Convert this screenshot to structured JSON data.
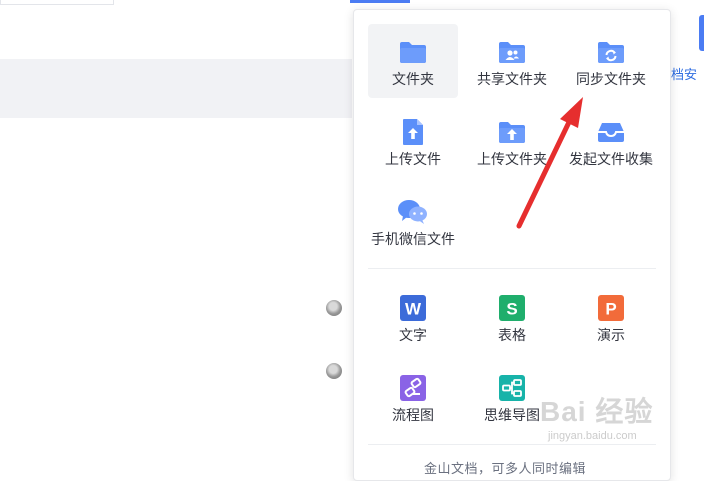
{
  "background": {
    "right_partial_text": "档安"
  },
  "new_menu": {
    "items": [
      {
        "label": "文件夹",
        "icon": "folder-icon"
      },
      {
        "label": "共享文件夹",
        "icon": "shared-folder-icon"
      },
      {
        "label": "同步文件夹",
        "icon": "sync-folder-icon"
      },
      {
        "label": "上传文件",
        "icon": "upload-file-icon"
      },
      {
        "label": "上传文件夹",
        "icon": "upload-folder-icon"
      },
      {
        "label": "发起文件收集",
        "icon": "file-collect-icon"
      },
      {
        "label": "手机微信文件",
        "icon": "wechat-icon"
      },
      {
        "label": "文字",
        "icon": "writer-doc-icon",
        "glyph": "W"
      },
      {
        "label": "表格",
        "icon": "spreadsheet-icon",
        "glyph": "S"
      },
      {
        "label": "演示",
        "icon": "presentation-icon",
        "glyph": "P"
      },
      {
        "label": "流程图",
        "icon": "flowchart-icon"
      },
      {
        "label": "思维导图",
        "icon": "mindmap-icon"
      }
    ],
    "footer": "金山文档，可多人同时编辑"
  },
  "watermark": {
    "main": "Bai 经验",
    "sub": "jingyan.baidu.com"
  },
  "colors": {
    "folder_blue": "#5b8ff9",
    "accent_blue": "#4b7cf3",
    "writer_blue": "#3c6bd9",
    "sheet_green": "#1fae6c",
    "slide_orange": "#f26b3a",
    "flow_purple": "#8a63e6",
    "mind_teal": "#17b3a9",
    "annotation_red": "#e62e2e"
  }
}
